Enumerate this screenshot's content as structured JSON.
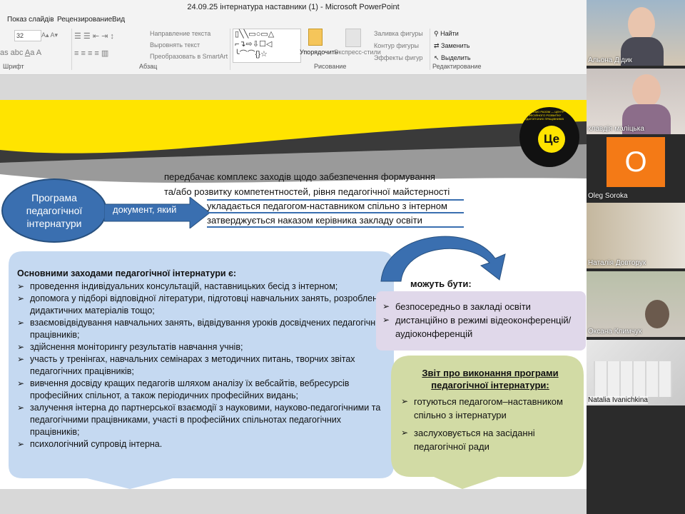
{
  "window": {
    "title": "24.09.25 інтернатура наставники (1) - Microsoft PowerPoint"
  },
  "tabs": [
    "Показ слайдів",
    "Рецензирование",
    "Вид"
  ],
  "ribbon": {
    "font_size": "32",
    "groups": {
      "font": "Шрифт",
      "paragraph": "Абзац",
      "drawing": "Рисование",
      "editing": "Редактирование"
    },
    "text_direction": "Направление текста",
    "align_text": "Выровнять текст",
    "smartart": "Преобразовать в SmartArt",
    "arrange": "Упорядочить",
    "quick_styles": "Экспресс-стили",
    "shape_fill": "Заливка фигуры",
    "shape_outline": "Контур фигуры",
    "shape_effects": "Эффекты фигур",
    "find": "Найти",
    "replace": "Заменить",
    "select": "Выделить"
  },
  "slide": {
    "logo_text": "Це",
    "logo_ring_text": "ПРАЦЮЄМО РАЗОМ — ЦЕНТР ПРОФЕСІЙНОГО РОЗВИТКУ ПЕДАГОГІЧНИХ ПРАЦІВНИКІВ",
    "program_oval": "Програма педагогічної інтернатури",
    "arrow_label": "документ, який",
    "definitions": [
      "передбачає комплекс заходів щодо забезпечення формування",
      "та/або розвитку компетентностей, рівня педагогічної майстерності",
      "укладається педагогом-наставником спільно з інтерном",
      "затверджується наказом керівника закладу освіти"
    ],
    "measures_title": "Основними заходами педагогічної інтернатури є:",
    "measures": [
      "проведення індивідуальних консультацій, наставницьких бесід з інтерном;",
      "допомога у підборі відповідної літератури, підготовці навчальних занять, розробленні дидактичних матеріалів тощо;",
      "взаємовідвідування навчальних занять, відвідування уроків досвідчених педагогічних працівників;",
      "здійснення моніторингу результатів навчання учнів;",
      "участь у тренінгах, навчальних семінарах з методичних питань, творчих звітах педагогічних працівників;",
      "вивчення досвіду кращих педагогів шляхом аналізу їх вебсайтів, вебресурсів професійних спільнот, а також періодичних професійних видань;",
      "залучення інтерна до партнерської взаємодії з науковими, науково-педагогічними та педагогічними працівниками, участі в професійних спільнотах педагогічних працівників;",
      "психологічний супровід інтерна."
    ],
    "can_be_title": "можуть бути:",
    "can_be": [
      "безпосередньо в закладі освіти",
      "дистанційно в режимі відеоконференцій/аудіоконференцій"
    ],
    "report_title": "Звіт про виконання програми педагогічної інтернатури:",
    "report": [
      "готуються педагогом–наставником спільно з інтернатури",
      "заслуховується на засіданні педагогічної ради"
    ]
  },
  "participants": [
    {
      "name": "Альона Дідик"
    },
    {
      "name": "клавдія маліцька"
    },
    {
      "name": "Oleg Soroka",
      "initial": "O"
    },
    {
      "name": "Наталія Довторук"
    },
    {
      "name": "Оксана Климчук"
    },
    {
      "name": "Natalia Ivanichkina"
    }
  ],
  "colors": {
    "yellow": "#ffe400",
    "blue_oval": "#3a6fb0",
    "light_blue": "#c5d9f1",
    "lavender": "#e0d8ea",
    "green_box": "#d2dba5",
    "orange_tile": "#f47a16"
  }
}
